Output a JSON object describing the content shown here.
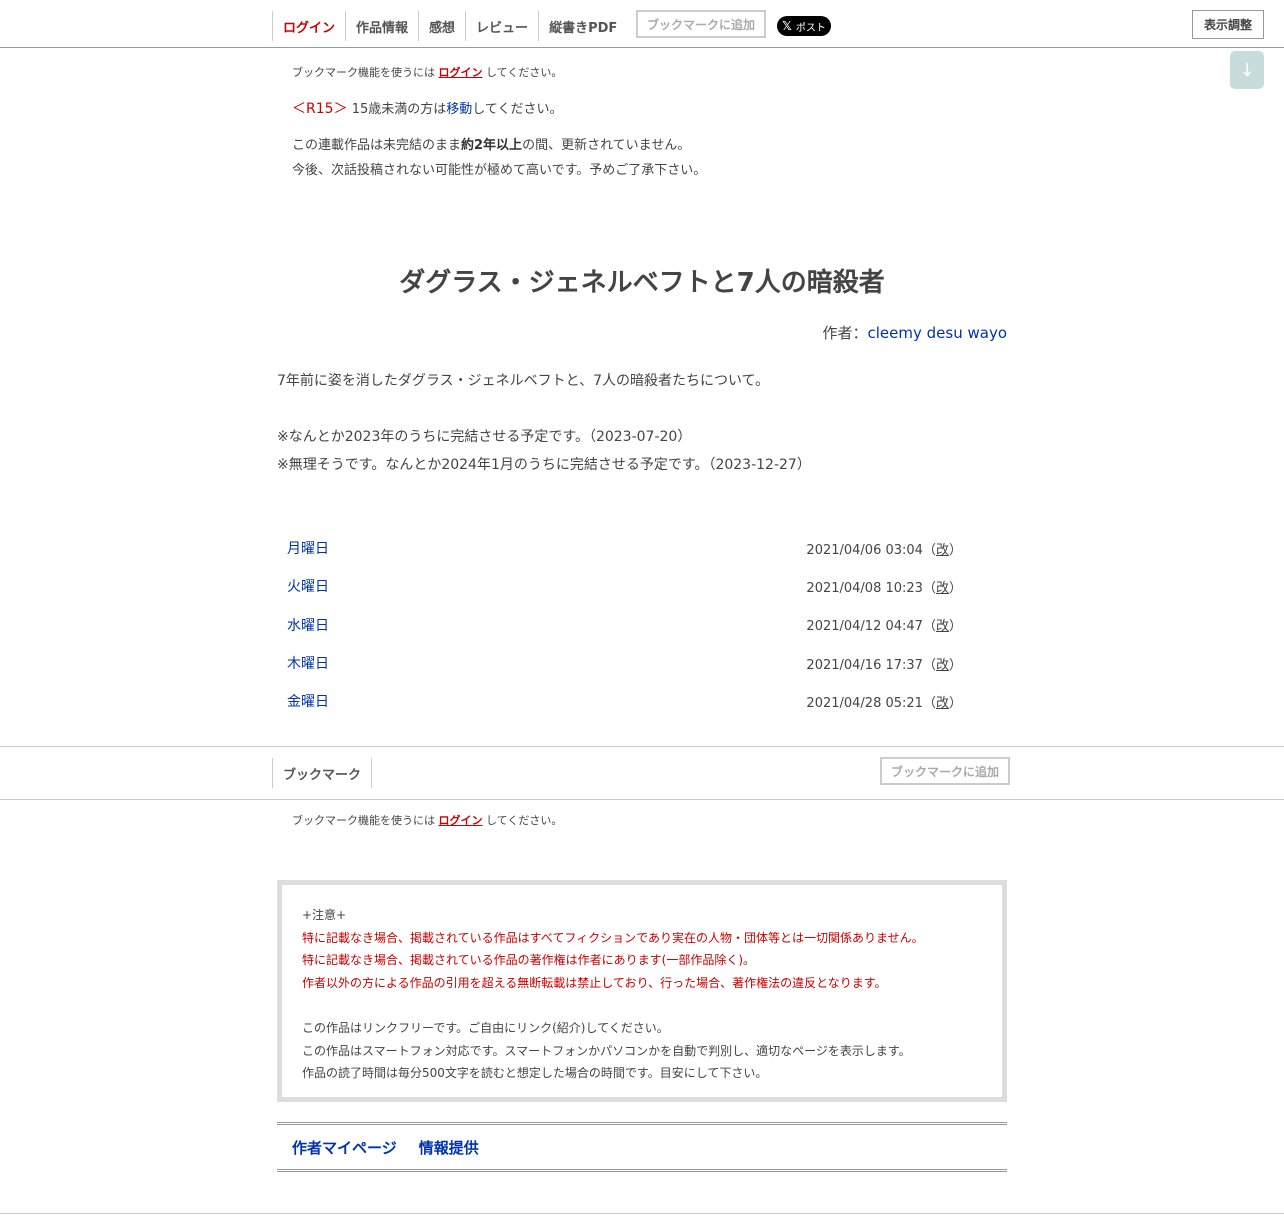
{
  "nav": {
    "items": [
      "ログイン",
      "作品情報",
      "感想",
      "レビュー",
      "縦書きPDF"
    ],
    "bookmark_add": "ブックマークに追加",
    "x_post": "ポスト",
    "display_settings": "表示調整",
    "scroll_down": "↓"
  },
  "bookmark_note": {
    "prefix": "ブックマーク機能を使うには",
    "link": "ログイン",
    "suffix": "してください。"
  },
  "r15": {
    "tag": "＜R15＞",
    "text1": "15歳未満の方は",
    "link": "移動",
    "text2": "してください。"
  },
  "hiatus": {
    "line1_a": "この連載作品は未完結のまま",
    "line1_bold": "約2年以上",
    "line1_b": "の間、更新されていません。",
    "line2": "今後、次話投稿されない可能性が極めて高いです。予めご了承下さい。"
  },
  "novel": {
    "title": "ダグラス・ジェネルベフトと7人の暗殺者",
    "author_label": "作者：",
    "author_name": "cleemy desu wayo",
    "synopsis": [
      "7年前に姿を消したダグラス・ジェネルベフトと、7人の暗殺者たちについて。",
      "",
      "※なんとか2023年のうちに完結させる予定です。（2023-07-20）",
      "※無理そうです。なんとか2024年1月のうちに完結させる予定です。（2023-12-27）"
    ]
  },
  "chapters": [
    {
      "title": "月曜日",
      "date": "2021/04/06 03:04",
      "revised": "改"
    },
    {
      "title": "火曜日",
      "date": "2021/04/08 10:23",
      "revised": "改"
    },
    {
      "title": "水曜日",
      "date": "2021/04/12 04:47",
      "revised": "改"
    },
    {
      "title": "木曜日",
      "date": "2021/04/16 17:37",
      "revised": "改"
    },
    {
      "title": "金曜日",
      "date": "2021/04/28 05:21",
      "revised": "改"
    }
  ],
  "bottom_bar": {
    "label": "ブックマーク",
    "bookmark_add": "ブックマークに追加"
  },
  "notice": {
    "heading": "+注意+",
    "red_lines": [
      "特に記載なき場合、掲載されている作品はすべてフィクションであり実在の人物・団体等とは一切関係ありません。",
      "特に記載なき場合、掲載されている作品の著作権は作者にあります(一部作品除く)。",
      "作者以外の方による作品の引用を超える無断転載は禁止しており、行った場合、著作権法の違反となります。"
    ],
    "lines": [
      "この作品はリンクフリーです。ご自由にリンク(紹介)してください。",
      "この作品はスマートフォン対応です。スマートフォンかパソコンかを自動で判別し、適切なページを表示します。",
      "作品の読了時間は毎分500文字を読むと想定した場合の時間です。目安にして下さい。"
    ]
  },
  "footer": {
    "links": [
      "作者マイページ",
      "情報提供"
    ]
  },
  "colors": {
    "link": "#0033aa",
    "accent_red": "#cc0000",
    "text": "#444444"
  }
}
